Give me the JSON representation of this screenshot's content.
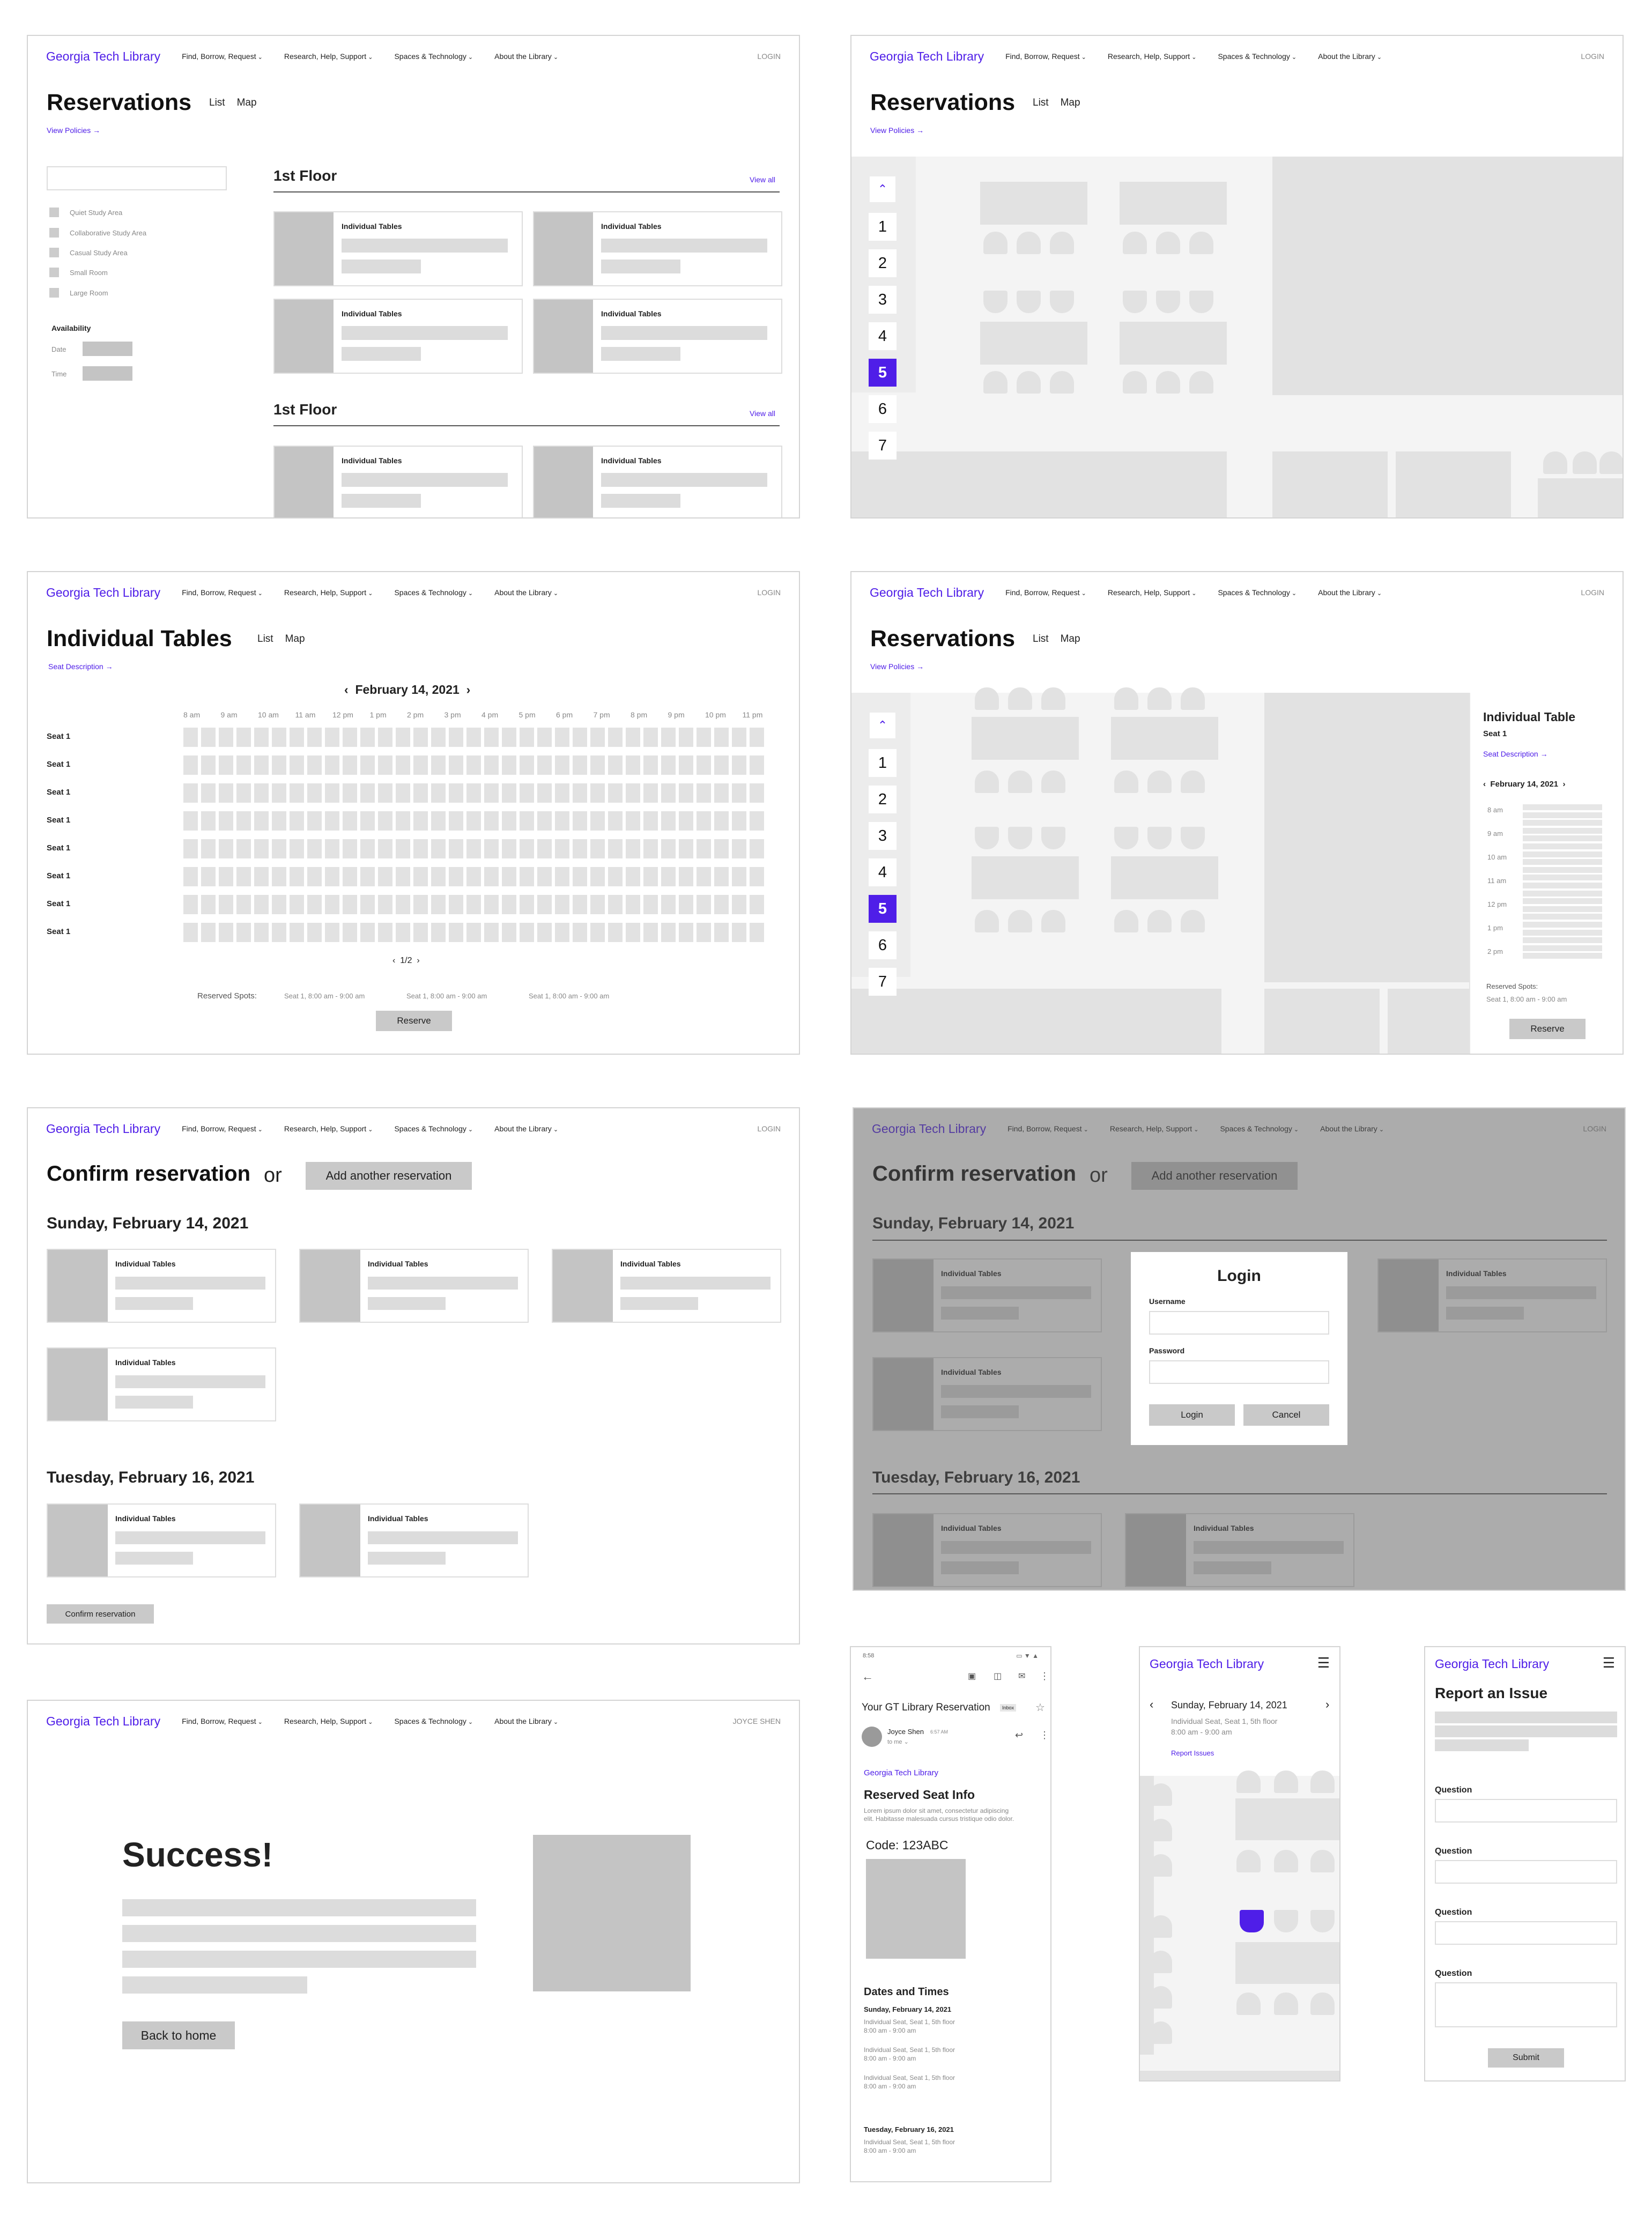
{
  "nav": {
    "brand": "Georgia Tech Library",
    "items": [
      "Find, Borrow, Request",
      "Research, Help, Support",
      "Spaces & Technology",
      "About the Library"
    ],
    "login": "LOGIN",
    "user": "JOYCE SHEN"
  },
  "list_view": {
    "title": "Reservations",
    "tab_list": "List",
    "tab_map": "Map",
    "policies": "View Policies →",
    "filters": [
      "Quiet Study Area",
      "Collaborative Study Area",
      "Casual Study Area",
      "Small Room",
      "Large Room"
    ],
    "availability": "Availability",
    "date_label": "Date",
    "time_label": "Time",
    "floor1": "1st Floor",
    "floor2": "1st Floor",
    "view_all": "View all",
    "card_title": "Individual Tables"
  },
  "map_view": {
    "title": "Reservations",
    "tab_list": "List",
    "tab_map": "Map",
    "policies": "View Policies →",
    "floors": [
      "1",
      "2",
      "3",
      "4",
      "5",
      "6",
      "7"
    ],
    "selected_floor": "5"
  },
  "schedule": {
    "title": "Individual Tables",
    "tab_list": "List",
    "tab_map": "Map",
    "seat_desc": "Seat Description →",
    "date": "February 14, 2021",
    "hours": [
      "8 am",
      "9 am",
      "10 am",
      "11 am",
      "12 pm",
      "1 pm",
      "2 pm",
      "3 pm",
      "4 pm",
      "5 pm",
      "6 pm",
      "7 pm",
      "8 pm",
      "9 pm",
      "10 pm",
      "11 pm"
    ],
    "seat_label": "Seat 1",
    "page": "1/2",
    "reserved_label": "Reserved Spots:",
    "reserved_spots": [
      "Seat 1, 8:00 am - 9:00 am",
      "Seat 1, 8:00 am - 9:00 am",
      "Seat 1, 8:00 am - 9:00 am"
    ],
    "reserve": "Reserve"
  },
  "map_detail": {
    "title": "Reservations",
    "tab_list": "List",
    "tab_map": "Map",
    "policies": "View Policies →",
    "panel_title": "Individual Table",
    "panel_seat": "Seat 1",
    "seat_desc": "Seat Description →",
    "date": "February 14, 2021",
    "hours": [
      "8 am",
      "9 am",
      "10 am",
      "11 am",
      "12 pm",
      "1 pm",
      "2 pm"
    ],
    "reserved_label": "Reserved Spots:",
    "reserved_spot": "Seat 1, 8:00 am - 9:00 am",
    "reserve": "Reserve"
  },
  "confirm": {
    "title": "Confirm reservation",
    "or": "or",
    "add_another": "Add another reservation",
    "day1": "Sunday, February 14, 2021",
    "day2": "Tuesday, February 16, 2021",
    "card_title": "Individual Tables",
    "confirm_btn": "Confirm reservation"
  },
  "login_modal": {
    "title": "Login",
    "username": "Username",
    "password": "Password",
    "login": "Login",
    "cancel": "Cancel"
  },
  "success": {
    "title": "Success!",
    "back": "Back to home"
  },
  "email": {
    "time": "8:58",
    "subject": "Your GT Library Reservation",
    "inbox": "Inbox",
    "sender": "Joyce Shen",
    "sent_time": "6:57 AM",
    "to": "to me ⌄",
    "brand": "Georgia Tech Library",
    "heading": "Reserved Seat Info",
    "lorem": "Lorem ipsum dolor sit amet, consectetur adipiscing elit. Habitasse malesuada cursus tristique odio dolor.",
    "code": "Code: 123ABC",
    "dates_heading": "Dates and Times",
    "day1": "Sunday, February 14, 2021",
    "day2": "Tuesday, February 16, 2021",
    "entry_line1": "Individual Seat, Seat 1, 5th floor",
    "entry_line2": "8:00 am - 9:00 am"
  },
  "mobile_map": {
    "brand": "Georgia Tech Library",
    "date": "Sunday, February 14, 2021",
    "detail1": "Individual Seat, Seat 1, 5th floor",
    "detail2": "8:00 am - 9:00 am",
    "report": "Report Issues"
  },
  "report": {
    "brand": "Georgia Tech Library",
    "title": "Report an Issue",
    "question": "Question",
    "submit": "Submit"
  },
  "colors": {
    "accent": "#4f1ee8",
    "placeholder": "#dcdcdc",
    "dark_placeholder": "#c4c4c4"
  }
}
